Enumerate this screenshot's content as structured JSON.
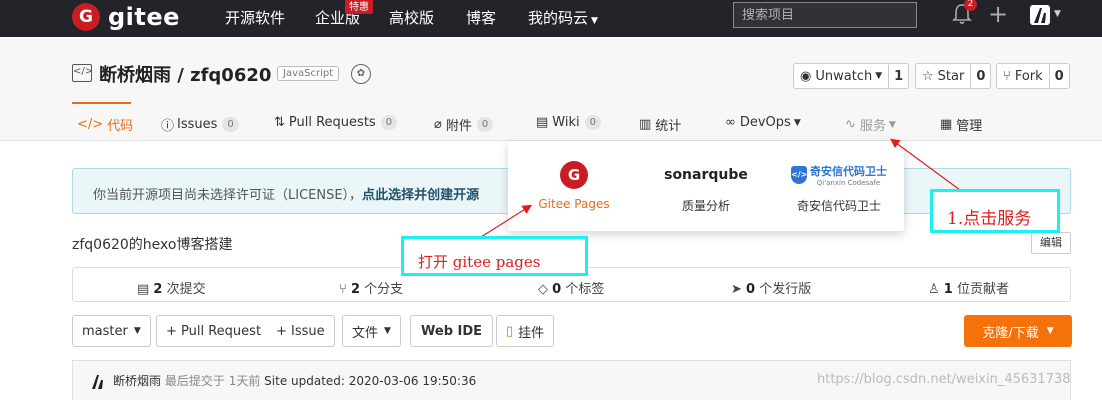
{
  "topnav": {
    "logo_text": "gitee",
    "logo_mark": "G",
    "items": [
      "开源软件",
      "企业版",
      "高校版",
      "博客",
      "我的码云"
    ],
    "hot_badge": "特惠",
    "search_placeholder": "搜索项目",
    "notification_count": "2",
    "plus": "+"
  },
  "repo": {
    "title": "断桥烟雨 / zfq0620",
    "language": "JavaScript",
    "unwatch_label": "Unwatch",
    "unwatch_count": "1",
    "star_label": "Star",
    "star_count": "0",
    "fork_label": "Fork",
    "fork_count": "0"
  },
  "tabs": [
    {
      "label": "代码",
      "count": ""
    },
    {
      "label": "Issues",
      "count": "0"
    },
    {
      "label": "Pull Requests",
      "count": "0"
    },
    {
      "label": "附件",
      "count": "0"
    },
    {
      "label": "Wiki",
      "count": "0"
    },
    {
      "label": "统计",
      "count": ""
    },
    {
      "label": "DevOps",
      "count": ""
    },
    {
      "label": "服务",
      "count": ""
    },
    {
      "label": "管理",
      "count": ""
    }
  ],
  "license_notice": {
    "text": "你当前开源项目尚未选择许可证（LICENSE），",
    "link": "点此选择并创建开源"
  },
  "description": "zfq0620的hexo博客搭建",
  "edit_label": "编辑",
  "stats": [
    {
      "num": "2",
      "label": "次提交"
    },
    {
      "num": "2",
      "label": "个分支"
    },
    {
      "num": "0",
      "label": "个标签"
    },
    {
      "num": "0",
      "label": "个发行版"
    },
    {
      "num": "1",
      "label": "位贡献者"
    }
  ],
  "toolbar": {
    "branch": "master",
    "pull_request": "+ Pull Request",
    "issue": "+ Issue",
    "files": "文件",
    "web_ide": "Web IDE",
    "bookmark": "挂件",
    "clone": "克隆/下载"
  },
  "commit": {
    "author": "断桥烟雨",
    "meta": "最后提交于",
    "time": "1天前",
    "message": "Site updated: 2020-03-06 19:50:36"
  },
  "services": [
    {
      "label": "Gitee Pages"
    },
    {
      "label": "质量分析",
      "logo": "sonarqube"
    },
    {
      "label": "奇安信代码卫士",
      "logo_title": "奇安信代码卫士",
      "logo_sub": "Qi'anxin Codesafe"
    }
  ],
  "annotations": {
    "step1": "1.点击服务",
    "step2": "打开 gitee pages"
  },
  "watermark": "https://blog.csdn.net/weixin_45631738",
  "colors": {
    "accent": "#e66c1a",
    "brand": "#c71d23",
    "annotation_border": "#1ef0f0",
    "annotation_text": "#e41b1b"
  }
}
